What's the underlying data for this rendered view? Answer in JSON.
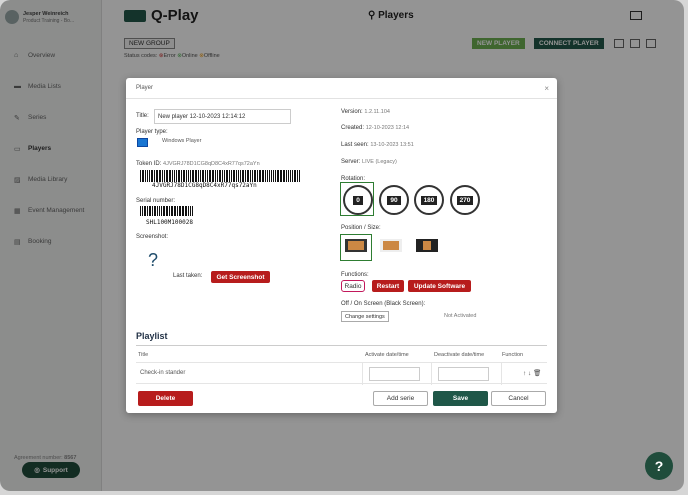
{
  "user": {
    "name": "Jesper Weinreich",
    "org": "Product Training - Bo..."
  },
  "sidebar": {
    "items": [
      {
        "label": "Overview",
        "icon": "home-icon"
      },
      {
        "label": "Media Lists",
        "icon": "folder-icon"
      },
      {
        "label": "Series",
        "icon": "edit-icon"
      },
      {
        "label": "Players",
        "icon": "monitor-icon"
      },
      {
        "label": "Media Library",
        "icon": "image-icon"
      },
      {
        "label": "Event Management",
        "icon": "calendar-icon"
      },
      {
        "label": "Booking",
        "icon": "grid-icon"
      }
    ],
    "agreement_label": "Agreement number:",
    "agreement_number": "8567",
    "support_label": "Support"
  },
  "header": {
    "logo": "Q-Play",
    "page_title": "Players"
  },
  "toolbar": {
    "new_group": "NEW GROUP",
    "status_codes_label": "Status codes:",
    "status_error": "Error",
    "status_online": "Online",
    "status_offline": "Offline",
    "new_player": "NEW PLAYER",
    "connect_player": "CONNECT PLAYER"
  },
  "modal": {
    "header": "Player",
    "close": "×",
    "title_label": "Title:",
    "title_value": "New player 12-10-2023 12:14:12",
    "player_type_label": "Player type:",
    "player_type_value": "Windows Player",
    "token_label": "Token ID:",
    "token_value": "4JVGRJ78D1CG8qD8C4xR77qs72aYn",
    "token_barcode_text": "4JVGRJ78D1CG8qD8C4xR77qs72aYn",
    "serial_label": "Serial number:",
    "serial_barcode_text": "SHL100M100028",
    "screenshot_label": "Screenshot:",
    "screenshot_placeholder": "?",
    "last_taken_label": "Last taken:",
    "get_screenshot": "Get Screenshot",
    "version_label": "Version:",
    "version_value": "1.2.11.104",
    "created_label": "Created:",
    "created_value": "12-10-2023 12:14",
    "last_seen_label": "Last seen:",
    "last_seen_value": "13-10-2023 13:51",
    "server_label": "Server:",
    "server_value": "LIVE (Legacy)",
    "rotation_label": "Rotation:",
    "rotations": [
      "0",
      "90",
      "180",
      "270"
    ],
    "position_label": "Position / Size:",
    "functions_label": "Functions:",
    "fn_radio": "Radio",
    "fn_restart": "Restart",
    "fn_update": "Update Software",
    "onoff_label": "Off / On Screen (Black Screen):",
    "change_settings": "Change settings",
    "not_activated": "Not Activated",
    "playlist_title": "Playlist",
    "col_title": "Title",
    "col_activate": "Activate date/time",
    "col_deactivate": "Deactivate date/time",
    "col_function": "Function",
    "row_title": "Check-in stander",
    "row_function_icons": "↑ ↓ 🗑",
    "delete": "Delete",
    "add_serie": "Add serie",
    "save": "Save",
    "cancel": "Cancel"
  },
  "help": "?"
}
